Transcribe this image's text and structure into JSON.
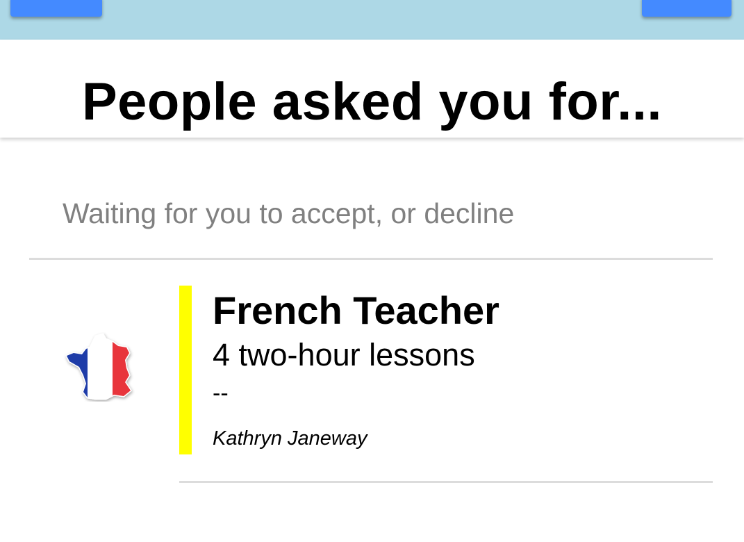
{
  "header": {
    "title": "People asked you for..."
  },
  "section": {
    "subheader": "Waiting for you to accept, or decline"
  },
  "requests": [
    {
      "title": "French Teacher",
      "subtitle": "4 two-hour lessons",
      "note": "--",
      "requester": "Kathryn Janeway",
      "icon": "france-flag-map-icon",
      "accent_color": "#ffff00"
    }
  ],
  "colors": {
    "topbar": "#add8e6",
    "topbar_button": "#448aff",
    "subheader_text": "#808080",
    "divider": "#dcdcdc"
  }
}
